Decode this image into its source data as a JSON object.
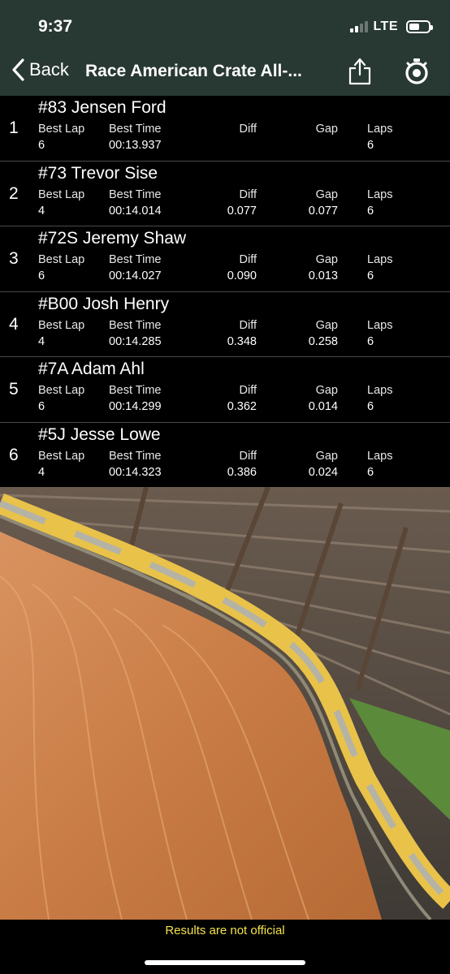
{
  "status": {
    "time": "9:37",
    "network": "LTE"
  },
  "nav": {
    "back_label": "Back",
    "title": "Race American Crate All-...",
    "share_icon": "share-icon",
    "stopwatch_icon": "stopwatch-icon"
  },
  "columns": {
    "best_lap": "Best Lap",
    "best_time": "Best Time",
    "diff": "Diff",
    "gap": "Gap",
    "laps": "Laps"
  },
  "results": [
    {
      "pos": "1",
      "driver": "#83 Jensen Ford",
      "best_lap": "6",
      "best_time": "00:13.937",
      "diff": "",
      "gap": "",
      "laps": "6"
    },
    {
      "pos": "2",
      "driver": "#73 Trevor Sise",
      "best_lap": "4",
      "best_time": "00:14.014",
      "diff": "0.077",
      "gap": "0.077",
      "laps": "6"
    },
    {
      "pos": "3",
      "driver": "#72S Jeremy Shaw",
      "best_lap": "6",
      "best_time": "00:14.027",
      "diff": "0.090",
      "gap": "0.013",
      "laps": "6"
    },
    {
      "pos": "4",
      "driver": "#B00 Josh Henry",
      "best_lap": "4",
      "best_time": "00:14.285",
      "diff": "0.348",
      "gap": "0.258",
      "laps": "6"
    },
    {
      "pos": "5",
      "driver": "#7A Adam Ahl",
      "best_lap": "6",
      "best_time": "00:14.299",
      "diff": "0.362",
      "gap": "0.014",
      "laps": "6"
    },
    {
      "pos": "6",
      "driver": "#5J Jesse Lowe",
      "best_lap": "4",
      "best_time": "00:14.323",
      "diff": "0.386",
      "gap": "0.024",
      "laps": "6"
    }
  ],
  "footer": {
    "notice": "Results are not official"
  },
  "colors": {
    "header_bg": "#283833",
    "notice": "#f3e24a",
    "dirt": "#c77c46"
  }
}
